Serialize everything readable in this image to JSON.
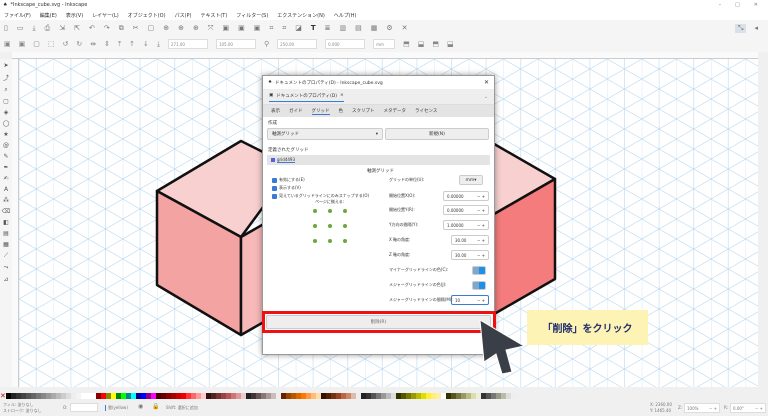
{
  "window": {
    "title": "*Inkscape_cube.svg - Inkscape",
    "controls": [
      "–",
      "□",
      "✕"
    ]
  },
  "menu": [
    "ファイル(F)",
    "編集(E)",
    "表示(V)",
    "レイヤー(L)",
    "オブジェクト(O)",
    "パス(P)",
    "テキスト(T)",
    "フィルター(S)",
    "エクステンション(N)",
    "ヘルプ(H)"
  ],
  "toolbar2": {
    "x": "271.00",
    "y": "105.00",
    "w": "250.00",
    "h": "0.000",
    "unit": "mm"
  },
  "dialog": {
    "title": "ドキュメントのプロパティ(D) - Inkscape_cube.svg",
    "tab": "ドキュメントのプロパティ(D)",
    "subtabs": [
      "表示",
      "ガイド",
      "グリッド",
      "色",
      "スクリプト",
      "メタデータ",
      "ライセンス"
    ],
    "active_subtab": "グリッド",
    "create_label": "作成",
    "grid_type": "軸測グリッド",
    "new_button": "新規(N)",
    "defined_label": "定義されたグリッド",
    "grid_id": "grid4493",
    "grid_heading": "軸測グリッド",
    "checkboxes": [
      "有効にする(E)",
      "表示する(V)",
      "見えているグリッドラインにのみスナップする(O)"
    ],
    "align_label": "ページに揃える:",
    "fields": [
      {
        "label": "グリッドの単位(U):",
        "value": "mm"
      },
      {
        "label": "開始位置X(O):",
        "value": "0.00000"
      },
      {
        "label": "開始位置Y(R):",
        "value": "0.00000"
      },
      {
        "label": "Y方向の間隔(Y):",
        "value": "1.00000"
      },
      {
        "label": "X 軸の角度:",
        "value": "30.00"
      },
      {
        "label": "Z 軸の角度:",
        "value": "30.00"
      },
      {
        "label": "マイナーグリッドラインの色(C):",
        "value": ""
      },
      {
        "label": "メジャーグリッドラインの色(J):",
        "value": ""
      },
      {
        "label": "メジャーグリッドラインの間隔(M):",
        "value": "10"
      }
    ],
    "delete_button": "削除(R)"
  },
  "callout": "「削除」をクリック",
  "colors": {
    "highlight": "#ee1111",
    "callout_bg": "#fdf3b5",
    "callout_text": "#1f2a6b",
    "grid": "#bcd9f0",
    "cube_face": "#f4a3a3"
  },
  "status": {
    "fill_label": "フィル:",
    "fill_value": "塗りなし",
    "stroke_label": "ストローク:",
    "stroke_value": "塗りなし",
    "opacity": "O:",
    "layer": "雲(yellow)",
    "message": "Shift: 選択に追加",
    "x": "X: 2360.00",
    "y": "Y: 1465.40",
    "zoom_label": "Z:",
    "zoom": "100%",
    "rotation_label": "R:",
    "rotation": "0.00°"
  }
}
